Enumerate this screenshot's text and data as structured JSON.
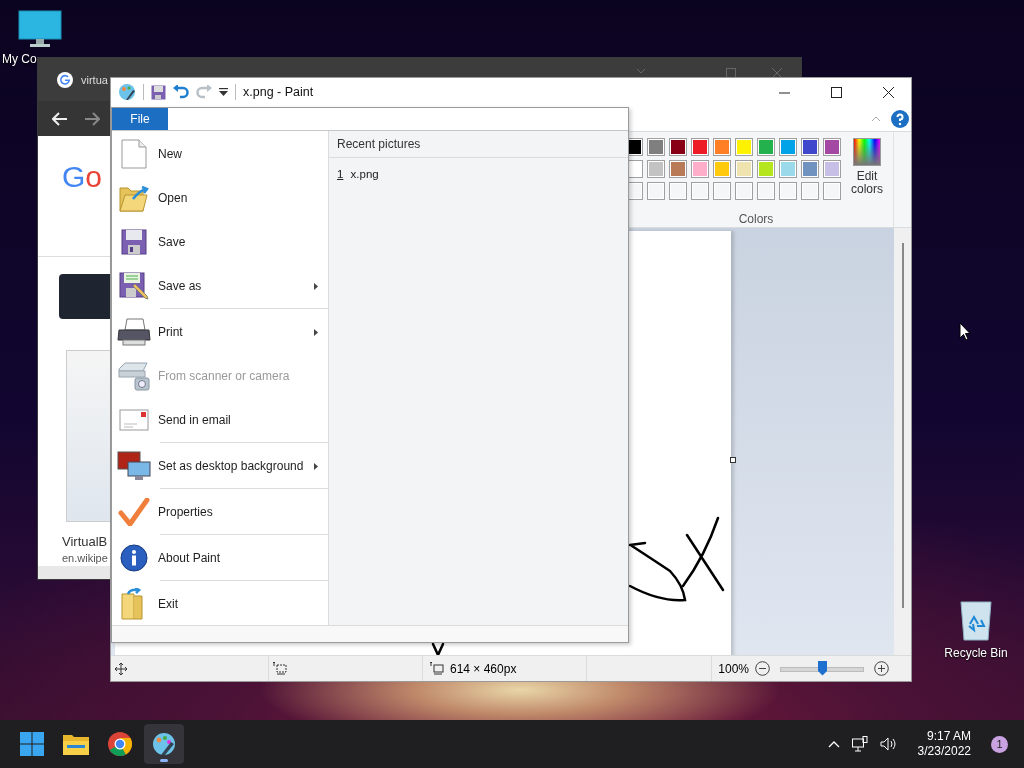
{
  "desktop_icons": [
    {
      "kind": "computer",
      "label": "My Co"
    },
    {
      "kind": "recycle-bin",
      "label": "Recycle Bin"
    }
  ],
  "browser_window": {
    "tab_title": "virtua",
    "logo": "Go",
    "result_title": "VirtualB",
    "result_url": "en.wikipe"
  },
  "paint_window": {
    "title": "x.png - Paint",
    "file_tab": "File",
    "file_menu": {
      "groups": [
        [
          {
            "kind": "new",
            "label": "New",
            "disabled": false,
            "submenu": false
          },
          {
            "kind": "open",
            "label": "Open",
            "disabled": false,
            "submenu": false
          },
          {
            "kind": "save",
            "label": "Save",
            "disabled": false,
            "submenu": false
          },
          {
            "kind": "save-as",
            "label": "Save as",
            "disabled": false,
            "submenu": true
          }
        ],
        [
          {
            "kind": "print",
            "label": "Print",
            "disabled": false,
            "submenu": true
          },
          {
            "kind": "scanner",
            "label": "From scanner or camera",
            "disabled": true,
            "submenu": false
          },
          {
            "kind": "email",
            "label": "Send in email",
            "disabled": false,
            "submenu": false
          }
        ],
        [
          {
            "kind": "wallpaper",
            "label": "Set as desktop background",
            "disabled": false,
            "submenu": true
          }
        ],
        [
          {
            "kind": "properties",
            "label": "Properties",
            "disabled": false,
            "submenu": false
          }
        ],
        [
          {
            "kind": "about",
            "label": "About Paint",
            "disabled": false,
            "submenu": false
          }
        ],
        [
          {
            "kind": "exit",
            "label": "Exit",
            "disabled": false,
            "submenu": false
          }
        ]
      ],
      "recent_heading": "Recent pictures",
      "recent": [
        {
          "number": "1",
          "name": "x.png"
        }
      ]
    },
    "palette": {
      "label": "Colors",
      "edit_colors": "Edit colors",
      "swatches": [
        {
          "kind": "filled",
          "color": "#000000"
        },
        {
          "kind": "filled",
          "color": "#7f7f7f"
        },
        {
          "kind": "filled",
          "color": "#880015"
        },
        {
          "kind": "filled",
          "color": "#ed1c24"
        },
        {
          "kind": "filled",
          "color": "#ff7f27"
        },
        {
          "kind": "filled",
          "color": "#fff200"
        },
        {
          "kind": "filled",
          "color": "#22b14c"
        },
        {
          "kind": "filled",
          "color": "#00a2e8"
        },
        {
          "kind": "filled",
          "color": "#3f48cc"
        },
        {
          "kind": "filled",
          "color": "#a349a4"
        },
        {
          "kind": "filled",
          "color": "#ffffff"
        },
        {
          "kind": "filled",
          "color": "#c3c3c3"
        },
        {
          "kind": "filled",
          "color": "#b97a57"
        },
        {
          "kind": "filled",
          "color": "#ffaec9"
        },
        {
          "kind": "filled",
          "color": "#ffc90e"
        },
        {
          "kind": "filled",
          "color": "#efe4b0"
        },
        {
          "kind": "filled",
          "color": "#b5e61d"
        },
        {
          "kind": "filled",
          "color": "#99d9ea"
        },
        {
          "kind": "filled",
          "color": "#7092be"
        },
        {
          "kind": "filled",
          "color": "#c8bfe7"
        },
        {
          "kind": "empty"
        },
        {
          "kind": "empty"
        },
        {
          "kind": "empty"
        },
        {
          "kind": "empty"
        },
        {
          "kind": "empty"
        },
        {
          "kind": "empty"
        },
        {
          "kind": "empty"
        },
        {
          "kind": "empty"
        },
        {
          "kind": "empty"
        },
        {
          "kind": "empty"
        }
      ]
    },
    "status_bar": {
      "image_size": "614 × 460px",
      "zoom": "100%",
      "zoom_level": {
        "level": 0.5
      }
    }
  },
  "taskbar": {
    "apps": [
      {
        "kind": "start",
        "selected": false
      },
      {
        "kind": "explorer",
        "selected": false
      },
      {
        "kind": "chrome",
        "selected": false
      },
      {
        "kind": "paint",
        "selected": true
      }
    ],
    "time": "9:17 AM",
    "date": "3/23/2022",
    "notification_count": "1"
  }
}
